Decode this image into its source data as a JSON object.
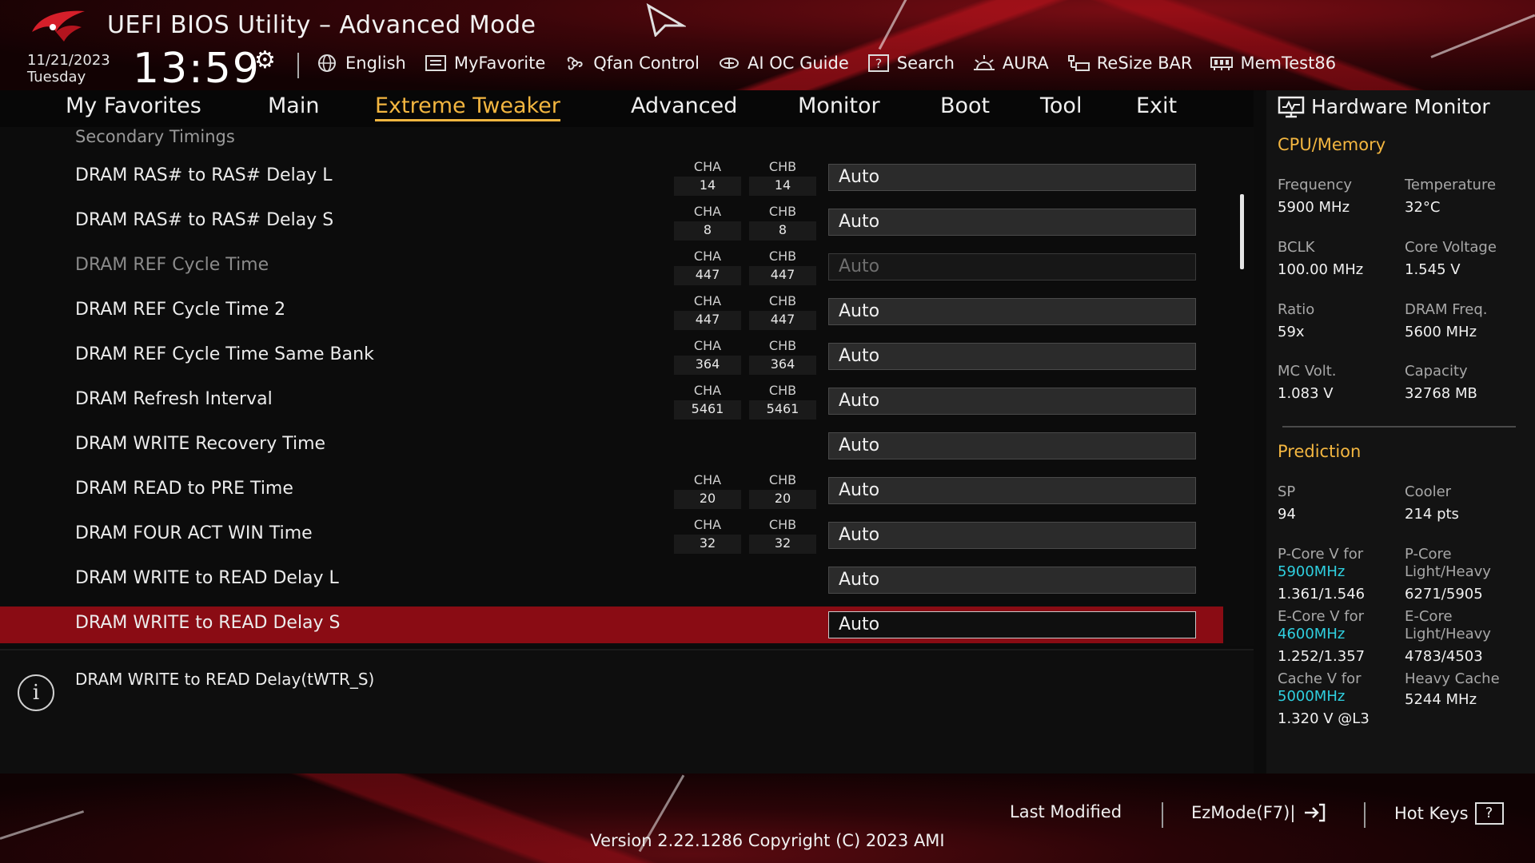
{
  "header": {
    "title": "UEFI BIOS Utility – Advanced Mode",
    "date": "11/21/2023",
    "day": "Tuesday",
    "time": "13:59",
    "toolbar": [
      {
        "label": "English",
        "icon": "globe-icon"
      },
      {
        "label": "MyFavorite",
        "icon": "favorite-list-icon"
      },
      {
        "label": "Qfan Control",
        "icon": "fan-icon"
      },
      {
        "label": "AI OC Guide",
        "icon": "ai-chip-icon"
      },
      {
        "label": "Search",
        "icon": "help-question-icon"
      },
      {
        "label": "AURA",
        "icon": "aura-light-icon"
      },
      {
        "label": "ReSize BAR",
        "icon": "resize-bar-icon"
      },
      {
        "label": "MemTest86",
        "icon": "memory-icon"
      }
    ]
  },
  "menu": {
    "items": [
      "My Favorites",
      "Main",
      "Extreme Tweaker",
      "Advanced",
      "Monitor",
      "Boot",
      "Tool",
      "Exit"
    ],
    "active": "Extreme Tweaker"
  },
  "main": {
    "section_title": "Secondary Timings",
    "channel_labels": {
      "a": "CHA",
      "b": "CHB"
    },
    "rows": [
      {
        "label": "DRAM RAS# to RAS# Delay L",
        "cha": "14",
        "chb": "14",
        "value": "Auto"
      },
      {
        "label": "DRAM RAS# to RAS# Delay S",
        "cha": "8",
        "chb": "8",
        "value": "Auto"
      },
      {
        "label": "DRAM REF Cycle Time",
        "cha": "447",
        "chb": "447",
        "value": "Auto",
        "disabled": true
      },
      {
        "label": "DRAM REF Cycle Time 2",
        "cha": "447",
        "chb": "447",
        "value": "Auto"
      },
      {
        "label": "DRAM REF Cycle Time Same Bank",
        "cha": "364",
        "chb": "364",
        "value": "Auto"
      },
      {
        "label": "DRAM Refresh Interval",
        "cha": "5461",
        "chb": "5461",
        "value": "Auto"
      },
      {
        "label": "DRAM WRITE Recovery Time",
        "cha": "",
        "chb": "",
        "value": "Auto"
      },
      {
        "label": "DRAM READ to PRE Time",
        "cha": "20",
        "chb": "20",
        "value": "Auto"
      },
      {
        "label": "DRAM FOUR ACT WIN Time",
        "cha": "32",
        "chb": "32",
        "value": "Auto"
      },
      {
        "label": "DRAM WRITE to READ Delay L",
        "cha": "",
        "chb": "",
        "value": "Auto"
      },
      {
        "label": "DRAM WRITE to READ Delay S",
        "cha": "",
        "chb": "",
        "value": "Auto",
        "selected": true
      }
    ]
  },
  "help": {
    "text": "DRAM WRITE to READ Delay(tWTR_S)"
  },
  "hw_monitor": {
    "title": "Hardware Monitor",
    "cpu_memory": {
      "title": "CPU/Memory",
      "items": [
        {
          "label": "Frequency",
          "value": "5900 MHz"
        },
        {
          "label": "Temperature",
          "value": "32°C"
        },
        {
          "label": "BCLK",
          "value": "100.00 MHz"
        },
        {
          "label": "Core Voltage",
          "value": "1.545 V"
        },
        {
          "label": "Ratio",
          "value": "59x"
        },
        {
          "label": "DRAM Freq.",
          "value": "5600 MHz"
        },
        {
          "label": "MC Volt.",
          "value": "1.083 V"
        },
        {
          "label": "Capacity",
          "value": "32768 MB"
        }
      ]
    },
    "prediction": {
      "title": "Prediction",
      "sp_label": "SP",
      "sp_value": "94",
      "cooler_label": "Cooler",
      "cooler_value": "214 pts",
      "pcore_v_label": "P-Core V for",
      "pcore_v_freq": "5900MHz",
      "pcore_v_value": "1.361/1.546",
      "pcore_lh_label": "P-Core Light/Heavy",
      "pcore_lh_value": "6271/5905",
      "ecore_v_label": "E-Core V for",
      "ecore_v_freq": "4600MHz",
      "ecore_v_value": "1.252/1.357",
      "ecore_lh_label": "E-Core Light/Heavy",
      "ecore_lh_value": "4783/4503",
      "cache_v_label": "Cache V for",
      "cache_v_freq": "5000MHz",
      "cache_v_value": "1.320 V @L3",
      "heavy_cache_label": "Heavy Cache",
      "heavy_cache_value": "5244 MHz"
    }
  },
  "footer": {
    "last_modified": "Last Modified",
    "ezmode": "EzMode(F7)|",
    "hotkeys": "Hot Keys",
    "hotkeys_glyph": "?",
    "version": "Version 2.22.1286 Copyright (C) 2023 AMI"
  },
  "colors": {
    "accent": "#f3b640",
    "selected_row": "#8a0c14",
    "highlight_freq": "#2fd0e0"
  }
}
